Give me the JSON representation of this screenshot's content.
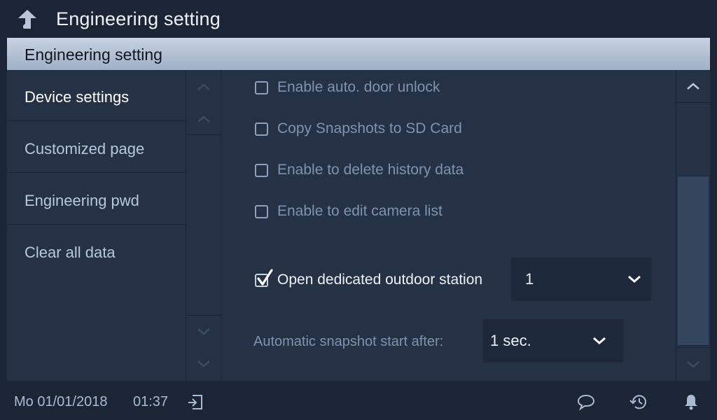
{
  "topbar": {
    "title": "Engineering setting"
  },
  "panel": {
    "header": "Engineering setting"
  },
  "sidebar": {
    "items": [
      {
        "label": "Device settings"
      },
      {
        "label": "Customized page"
      },
      {
        "label": "Engineering pwd"
      },
      {
        "label": "Clear all data"
      }
    ]
  },
  "settings": {
    "auto_unlock": {
      "label": "Enable auto. door unlock",
      "checked": false
    },
    "copy_snapshots": {
      "label": "Copy Snapshots to SD Card",
      "checked": false
    },
    "delete_history": {
      "label": "Enable to delete history data",
      "checked": false
    },
    "edit_camera": {
      "label": "Enable to edit camera list",
      "checked": false
    },
    "dedicated_station": {
      "label": "Open dedicated outdoor station",
      "checked": true,
      "value": "1"
    },
    "snapshot": {
      "label": "Automatic snapshot start after:",
      "value": "1 sec."
    }
  },
  "status": {
    "date": "Mo 01/01/2018",
    "time": "01:37"
  },
  "icons": {
    "back": "back-arrow-icon",
    "exit": "exit-icon",
    "message": "message-icon",
    "history": "history-icon",
    "bell": "bell-icon"
  },
  "colors": {
    "background": "#1b2535",
    "panel": "#253246",
    "header": "#b7c4d6",
    "muted_text": "#7f93ad"
  }
}
